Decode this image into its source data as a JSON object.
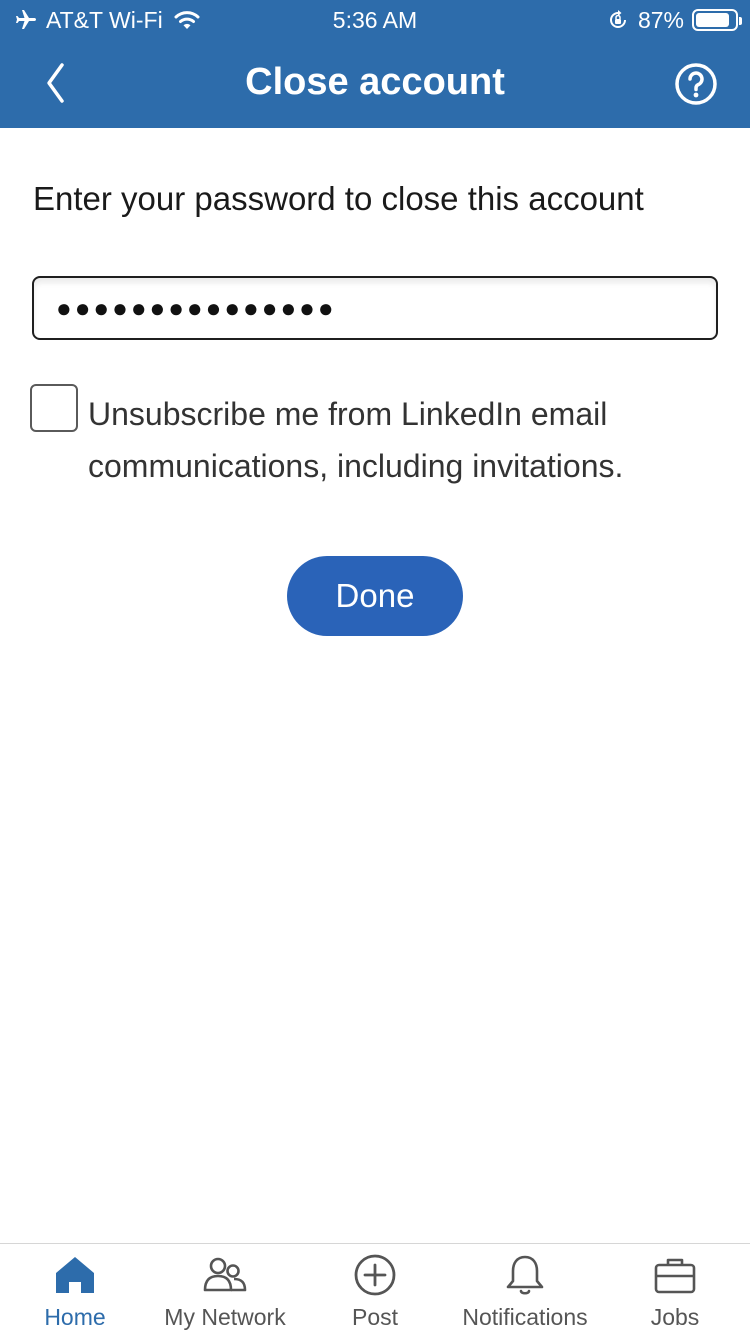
{
  "status_bar": {
    "carrier": "AT&T Wi-Fi",
    "time": "5:36 AM",
    "battery_percent": "87%",
    "battery_level": 0.87,
    "icons": [
      "airplane-icon",
      "wifi-icon",
      "orientation-lock-icon",
      "battery-icon"
    ]
  },
  "nav": {
    "title": "Close account",
    "back_icon": "chevron-left-icon",
    "help_icon": "question-circle-icon"
  },
  "form": {
    "instruction": "Enter your password to close this account",
    "password_masked": "●●●●●●●●●●●●●●●",
    "unsubscribe_label": "Unsubscribe me from LinkedIn email communications, including invitations.",
    "unsubscribe_checked": false,
    "done_label": "Done"
  },
  "tabs": [
    {
      "label": "Home",
      "icon": "home-icon",
      "active": true
    },
    {
      "label": "My Network",
      "icon": "my-network-icon",
      "active": false
    },
    {
      "label": "Post",
      "icon": "post-icon",
      "active": false
    },
    {
      "label": "Notifications",
      "icon": "bell-icon",
      "active": false
    },
    {
      "label": "Jobs",
      "icon": "briefcase-icon",
      "active": false
    }
  ],
  "colors": {
    "header_background": "#2d6cab",
    "primary_button": "#2a63b8",
    "active_tab": "#2d6cab",
    "inactive_tab": "#555555"
  }
}
